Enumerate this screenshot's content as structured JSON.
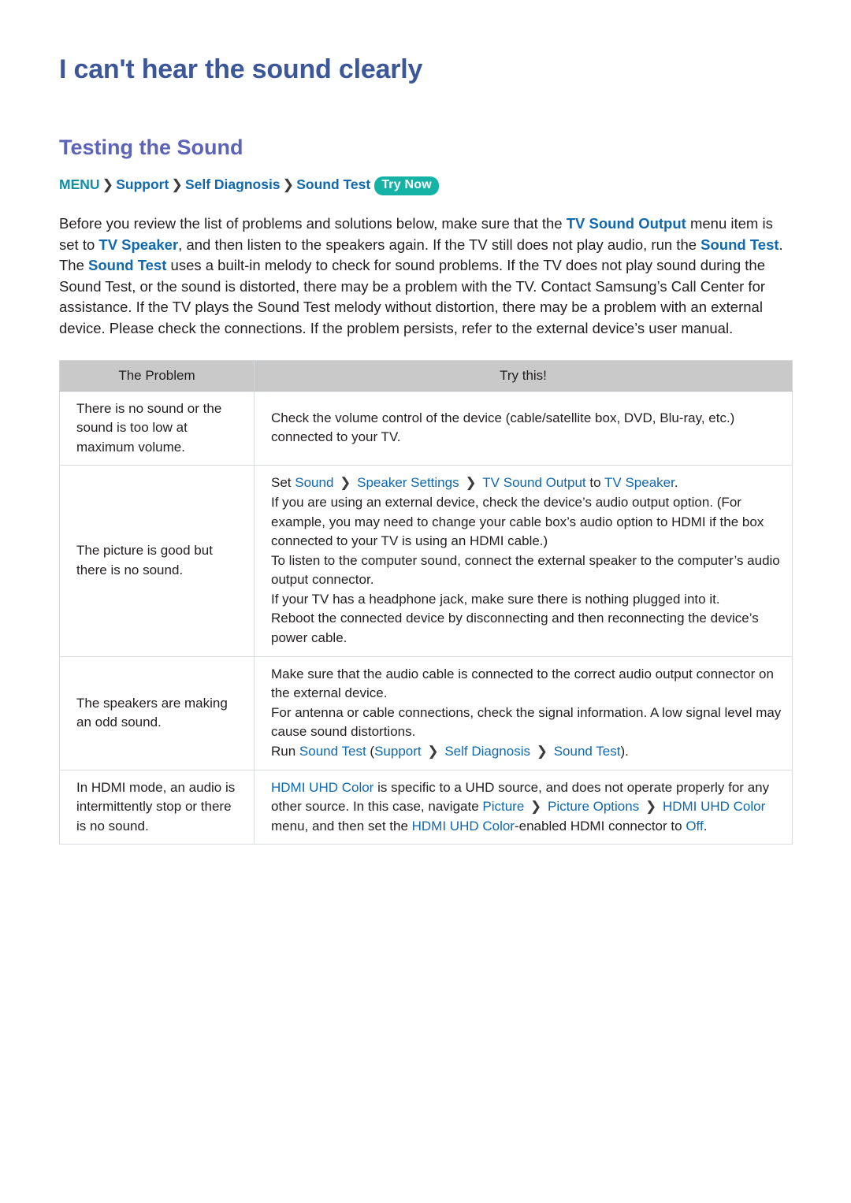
{
  "page": {
    "title": "I can't hear the sound clearly",
    "section_title": "Testing the Sound"
  },
  "breadcrumb": {
    "menu": "MENU",
    "separator": "❯",
    "items": [
      "Support",
      "Self Diagnosis",
      "Sound Test"
    ],
    "badge": "Try Now"
  },
  "intro": {
    "t1": "Before you review the list of problems and solutions below, make sure that the ",
    "h1": "TV Sound Output",
    "t2": " menu item is set to ",
    "h2": "TV Speaker",
    "t3": ", and then listen to the speakers again. If the TV still does not play audio, run the ",
    "h3": "Sound Test",
    "t4": ". The ",
    "h4": "Sound Test",
    "t5": " uses a built-in melody to check for sound problems. If the TV does not play sound during the Sound Test, or the sound is distorted, there may be a problem with the TV. Contact Samsung’s Call Center for assistance. If the TV plays the Sound Test melody without distortion, there may be a problem with an external device. Please check the connections. If the problem persists, refer to the external device’s user manual."
  },
  "table": {
    "headers": {
      "problem": "The Problem",
      "try_this": "Try this!"
    },
    "rows": [
      {
        "problem": "There is no sound or the sound is too low at maximum volume.",
        "solution_plain": "Check the volume control of the device (cable/satellite box, DVD, Blu-ray, etc.) connected to your TV."
      },
      {
        "problem": "The picture is good but there is no sound.",
        "line1_set": "Set ",
        "line1_a": "Sound",
        "line1_sep1": " ❯ ",
        "line1_b": "Speaker Settings",
        "line1_sep2": " ❯ ",
        "line1_c": "TV Sound Output",
        "line1_to": " to ",
        "line1_d": "TV Speaker",
        "line1_end": ".",
        "line2": "If you are using an external device, check the device’s audio output option. (For example, you may need to change your cable box’s audio option to HDMI if the box connected to your TV is using an HDMI cable.)",
        "line3": "To listen to the computer sound, connect the external speaker to the computer’s audio output connector.",
        "line4": "If your TV has a headphone jack, make sure there is nothing plugged into it.",
        "line5": "Reboot the connected device by disconnecting and then reconnecting the device’s power cable."
      },
      {
        "problem": "The speakers are making an odd sound.",
        "line1": "Make sure that the audio cable is connected to the correct audio output connector on the external device.",
        "line2": "For antenna or cable connections, check the signal information. A low signal level may cause sound distortions.",
        "line3_run": "Run ",
        "line3_a": "Sound Test",
        "line3_paren_open": " (",
        "line3_b": "Support",
        "line3_sep1": " ❯ ",
        "line3_c": "Self Diagnosis",
        "line3_sep2": " ❯ ",
        "line3_d": "Sound Test",
        "line3_end": ")."
      },
      {
        "problem": "In HDMI mode, an audio is intermittently stop or there is no sound.",
        "s_a": "HDMI UHD Color",
        "s_t1": " is specific to a UHD source, and does not operate properly for any other source. In this case, navigate ",
        "s_b": "Picture",
        "s_sep1": " ❯ ",
        "s_c": "Picture Options",
        "s_sep2": " ❯ ",
        "s_d": "HDMI UHD Color",
        "s_t2": " menu, and then set the ",
        "s_e": "HDMI UHD Color",
        "s_t3": "-enabled HDMI connector to ",
        "s_f": "Off",
        "s_t4": "."
      }
    ]
  },
  "colors": {
    "title": "#3b5699",
    "section": "#5d63b8",
    "link": "#1068ad",
    "menu_teal": "#0f8fa0",
    "badge_bg": "#14b3a6",
    "header_bg": "#c9c9c9"
  }
}
